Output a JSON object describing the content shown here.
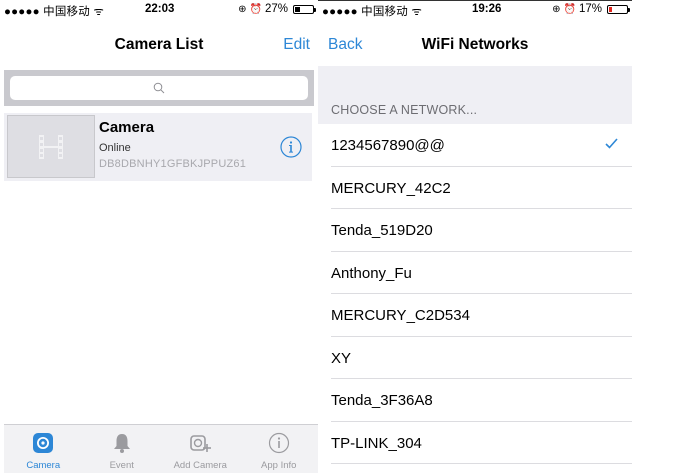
{
  "left": {
    "status": {
      "carrier": "●●●●● 中国移动 ᯤ",
      "time": "22:03",
      "battery": "27%",
      "battery_level": 0.27
    },
    "nav": {
      "title": "Camera List",
      "edit_label": "Edit"
    },
    "search": {
      "placeholder_icon": "search-icon"
    },
    "camera": {
      "name": "Camera",
      "status": "Online",
      "id": "DB8DBNHY1GFBKJPPUZ61"
    },
    "tabs": [
      {
        "label": "Camera",
        "icon": "camera-icon",
        "active": true
      },
      {
        "label": "Event",
        "icon": "bell-icon",
        "active": false
      },
      {
        "label": "Add Camera",
        "icon": "add-camera-icon",
        "active": false
      },
      {
        "label": "App Info",
        "icon": "info-icon",
        "active": false
      }
    ]
  },
  "right": {
    "status": {
      "carrier": "●●●●● 中国移动 ᯤ",
      "time": "19:26",
      "battery": "17%",
      "battery_level": 0.17
    },
    "nav": {
      "title": "WiFi Networks",
      "back_label": "Back"
    },
    "section_header": "CHOOSE A NETWORK...",
    "networks": [
      {
        "name": "1234567890@@",
        "selected": true
      },
      {
        "name": "MERCURY_42C2",
        "selected": false
      },
      {
        "name": "Tenda_519D20",
        "selected": false
      },
      {
        "name": "Anthony_Fu",
        "selected": false
      },
      {
        "name": "MERCURY_C2D534",
        "selected": false
      },
      {
        "name": "XY",
        "selected": false
      },
      {
        "name": "Tenda_3F36A8",
        "selected": false
      },
      {
        "name": "TP-LINK_304",
        "selected": false
      }
    ]
  },
  "colors": {
    "accent": "#2d87d6",
    "battery_low": "#e0261d",
    "group_bg": "#efeff4"
  }
}
